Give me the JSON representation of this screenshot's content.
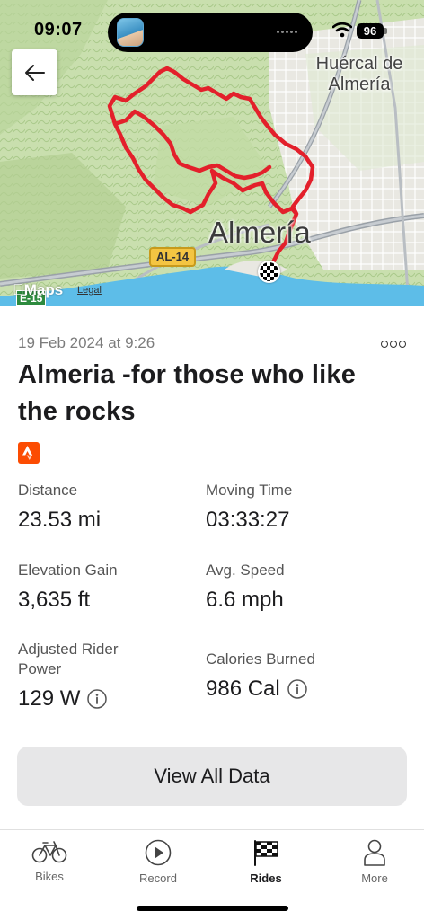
{
  "status_bar": {
    "time": "09:07",
    "battery": "96"
  },
  "map": {
    "labels": {
      "huercal": "Huércal de Almería",
      "almeria": "Almería",
      "road": "AL-14",
      "road_e": "E-15"
    },
    "attribution": {
      "brand": "Maps",
      "legal": "Legal"
    },
    "route_color": "#e3202b"
  },
  "ride": {
    "date": "19 Feb 2024 at 9:26",
    "title": "Almeria -for those who like the rocks",
    "source_icon": "strava-icon",
    "stats": [
      {
        "label": "Distance",
        "value": "23.53 mi"
      },
      {
        "label": "Moving Time",
        "value": "03:33:27"
      },
      {
        "label": "Elevation Gain",
        "value": "3,635 ft"
      },
      {
        "label": "Avg. Speed",
        "value": "6.6 mph"
      },
      {
        "label": "Adjusted Rider Power",
        "value": "129 W",
        "info": true
      },
      {
        "label": "Calories Burned",
        "value": "986 Cal",
        "info": true
      }
    ],
    "view_all_label": "View All Data"
  },
  "tabs": [
    {
      "label": "Bikes",
      "icon": "bike-icon"
    },
    {
      "label": "Record",
      "icon": "play-icon"
    },
    {
      "label": "Rides",
      "icon": "checkered-flag-icon",
      "active": true
    },
    {
      "label": "More",
      "icon": "person-icon"
    }
  ],
  "colors": {
    "accent_strava": "#fc4c02",
    "button_bg": "#e7e7e8",
    "route": "#e3202b"
  }
}
